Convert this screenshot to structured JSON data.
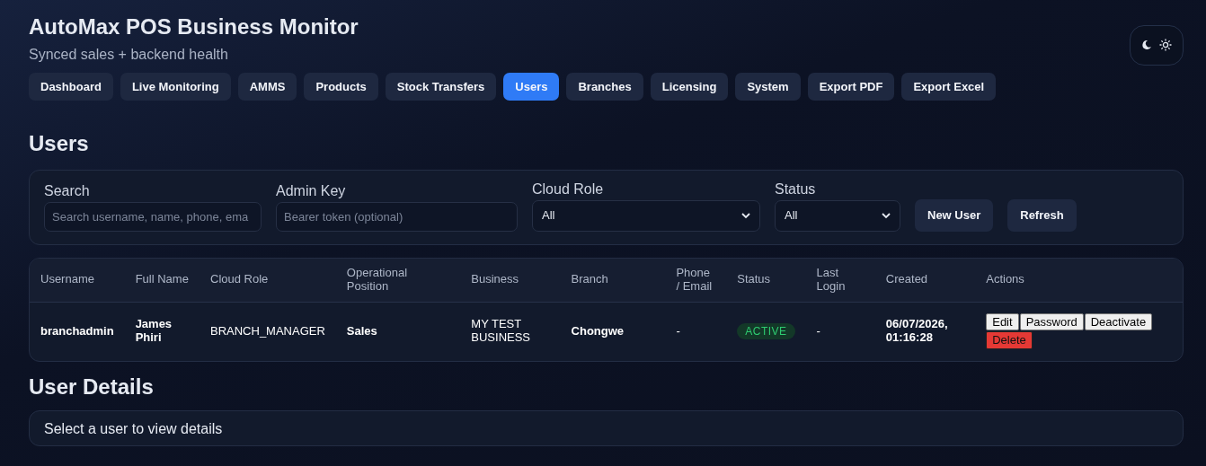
{
  "header": {
    "title": "AutoMax POS Business Monitor",
    "subtitle": "Synced sales + backend health"
  },
  "nav": [
    {
      "label": "Dashboard",
      "selected": false
    },
    {
      "label": "Live Monitoring",
      "selected": false
    },
    {
      "label": "AMMS",
      "selected": false
    },
    {
      "label": "Products",
      "selected": false
    },
    {
      "label": "Stock Transfers",
      "selected": false
    },
    {
      "label": "Users",
      "selected": true
    },
    {
      "label": "Branches",
      "selected": false
    },
    {
      "label": "Licensing",
      "selected": false
    },
    {
      "label": "System",
      "selected": false
    },
    {
      "label": "Export PDF",
      "selected": false
    },
    {
      "label": "Export Excel",
      "selected": false
    }
  ],
  "users_section": {
    "title": "Users",
    "filters": [
      {
        "kind": "input",
        "label": "Search",
        "placeholder": "Search username, name, phone, ema"
      },
      {
        "kind": "input",
        "label": "Admin Key",
        "placeholder": "Bearer token (optional)"
      },
      {
        "kind": "select",
        "label": "Cloud Role",
        "value": "All"
      },
      {
        "kind": "select",
        "label": "Status",
        "value": "All"
      }
    ],
    "buttons": [
      "New User",
      "Refresh"
    ],
    "table": {
      "columns": [
        "Username",
        "Full Name",
        "Cloud Role",
        "Operational Position",
        "Business",
        "Branch",
        "Phone / Email",
        "Status",
        "Last Login",
        "Created",
        "Actions"
      ],
      "rows": [
        {
          "username": "branchadmin",
          "full_name": "James Phiri",
          "cloud_role": "BRANCH_MANAGER",
          "position": "Sales",
          "business": "MY TEST BUSINESS",
          "branch": "Chongwe",
          "phone_email": "-",
          "status": "ACTIVE",
          "active": true,
          "last_login": "-",
          "created": "06/07/2026, 01:16:28",
          "actions": [
            {
              "label": "Edit",
              "kind": "normal"
            },
            {
              "label": "Password",
              "kind": "normal"
            },
            {
              "label": "Deactivate",
              "kind": "normal"
            },
            {
              "label": "Delete",
              "kind": "danger"
            }
          ]
        }
      ]
    }
  },
  "details_section": {
    "title": "User Details",
    "message": "Select a user to view details"
  }
}
